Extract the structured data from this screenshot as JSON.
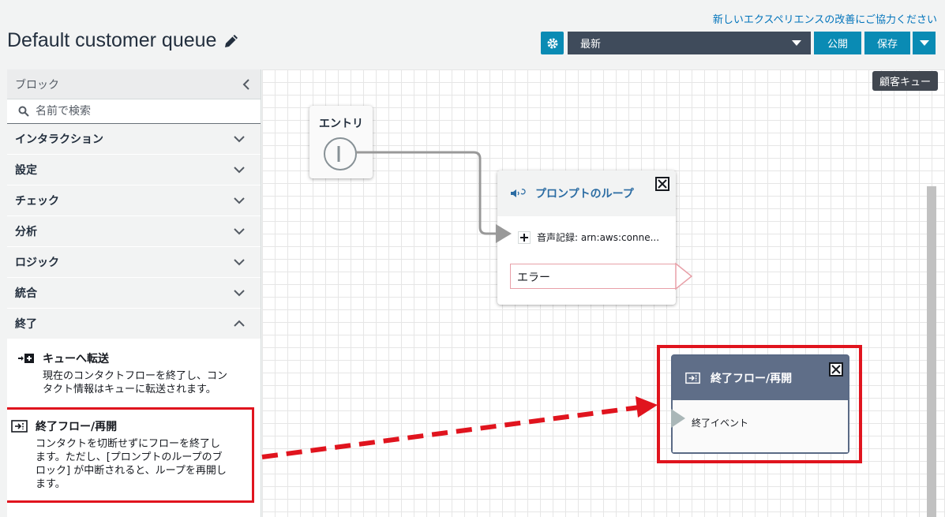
{
  "header": {
    "feedback_link": "新しいエクスペリエンスの改善にご協力ください",
    "page_title": "Default customer queue",
    "version_select": "最新",
    "publish_label": "公開",
    "save_label": "保存"
  },
  "sidebar": {
    "title": "ブロック",
    "search_placeholder": "名前で検索",
    "categories": [
      {
        "label": "インタラクション"
      },
      {
        "label": "設定"
      },
      {
        "label": "チェック"
      },
      {
        "label": "分析"
      },
      {
        "label": "ロジック"
      },
      {
        "label": "統合"
      },
      {
        "label": "終了"
      }
    ],
    "end_items": [
      {
        "name": "キューへ転送",
        "desc_1": "現在のコンタクトフローを終了し、コン",
        "desc_2": "タクト情報はキューに転送されます。"
      },
      {
        "name": "終了フロー/再開",
        "desc_1": "コンタクトを切断せずにフローを終了し",
        "desc_2": "ます。ただし、[プロンプトのループのブ",
        "desc_3": "ロック] が中断されると、ループを再開し",
        "desc_4": "ます。"
      }
    ]
  },
  "canvas": {
    "flow_type_tag": "顧客キュー",
    "entry_label": "エントリ",
    "prompt_block": {
      "title": "プロンプトのループ",
      "branch_label": "音声記録: arn:aws:conne...",
      "error_label": "エラー"
    },
    "end_block": {
      "title": "終了フロー/再開",
      "event_label": "終了イベント"
    }
  },
  "colors": {
    "accent": "#0a8bb4",
    "version_bar": "#3f4b5b",
    "highlight": "#e0141e",
    "end_block_header": "#5f6e88",
    "link": "#0073bb"
  }
}
